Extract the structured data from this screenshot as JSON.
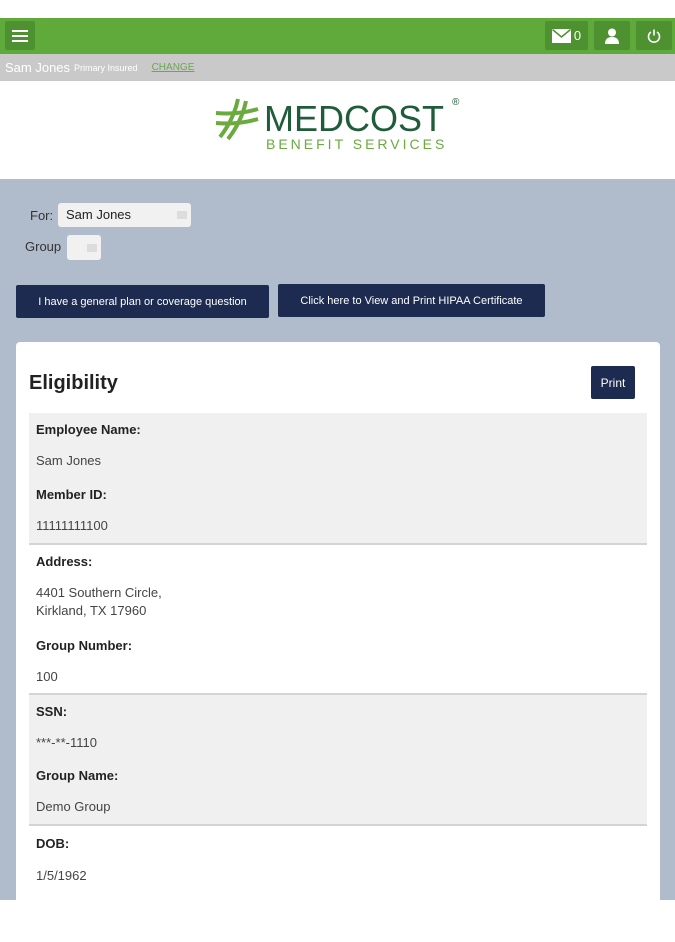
{
  "topbar": {
    "mail_count": "0"
  },
  "subbar": {
    "name": "Sam Jones",
    "role": "Primary Insured",
    "change": "CHANGE"
  },
  "logo": {
    "main": "MEDCOST",
    "reg": "®",
    "sub": "BENEFIT SERVICES"
  },
  "filters": {
    "for_label": "For:",
    "for_value": "Sam Jones",
    "group_label": "Group"
  },
  "buttons": {
    "question": "I have a general plan or coverage question",
    "hipaa": "Click here to View and Print HIPAA Certificate"
  },
  "card": {
    "title": "Eligibility",
    "print": "Print"
  },
  "fields": {
    "employee_name_label": "Employee Name:",
    "employee_name": "Sam Jones",
    "member_id_label": "Member ID:",
    "member_id": "11111111100",
    "address_label": "Address:",
    "address_line1": "4401 Southern Circle,",
    "address_line2": "Kirkland, TX 17960",
    "group_number_label": "Group Number:",
    "group_number": "100",
    "ssn_label": "SSN:",
    "ssn": "***-**-1110",
    "group_name_label": "Group Name:",
    "group_name": "Demo Group",
    "dob_label": "DOB:",
    "dob": "1/5/1962"
  },
  "colors": {
    "topbar": "#5faa3a",
    "navy": "#1c2b4f",
    "page_bg": "#b0bccc"
  }
}
